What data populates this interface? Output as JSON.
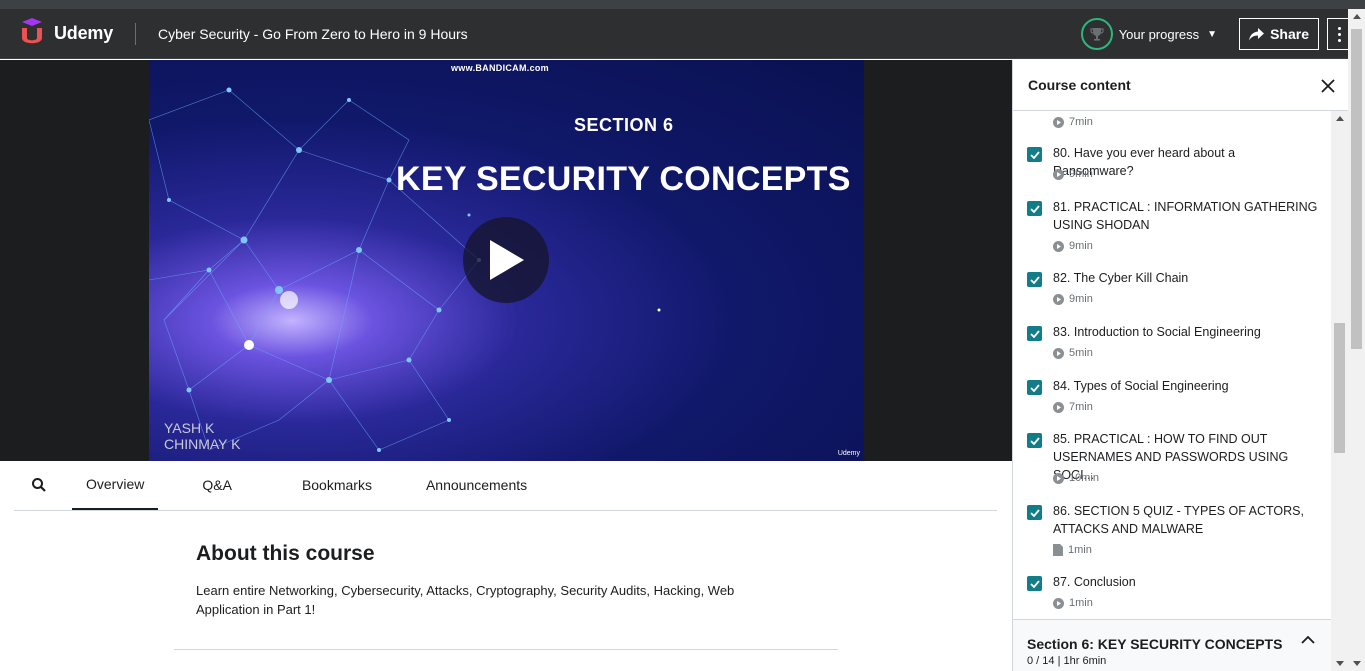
{
  "header": {
    "brand": "Udemy",
    "course_title": "Cyber Security - Go From Zero to Hero in 9 Hours",
    "progress_label": "Your progress",
    "share_label": "Share",
    "colors": {
      "bar": "#2d2f31",
      "brand": "#a435f0",
      "progress_ring": "#2eb67d"
    }
  },
  "video": {
    "watermark": "www.BANDICAM.com",
    "section": "SECTION 6",
    "title": "KEY SECURITY CONCEPTS",
    "author_1": "YASH K",
    "author_2": "CHINMAY K",
    "corner_logo": "Udemy"
  },
  "tabs": [
    {
      "label": "Overview",
      "active": true
    },
    {
      "label": "Q&A",
      "active": false
    },
    {
      "label": "Bookmarks",
      "active": false
    },
    {
      "label": "Announcements",
      "active": false
    }
  ],
  "about": {
    "heading": "About this course",
    "text": "Learn entire Networking, Cybersecurity, Attacks, Cryptography, Security Audits, Hacking, Web Application in Part 1!"
  },
  "sidebar": {
    "title": "Course content",
    "first_duration": "7min",
    "items": [
      {
        "title": "80. Have you ever heard about a Ransomware?",
        "duration": "9min",
        "type": "video",
        "checked": true
      },
      {
        "title": "81. PRACTICAL : INFORMATION GATHERING USING SHODAN",
        "duration": "9min",
        "type": "video",
        "checked": true
      },
      {
        "title": "82. The Cyber Kill Chain",
        "duration": "9min",
        "type": "video",
        "checked": true
      },
      {
        "title": "83. Introduction to Social Engineering",
        "duration": "5min",
        "type": "video",
        "checked": true
      },
      {
        "title": "84. Types of Social Engineering",
        "duration": "7min",
        "type": "video",
        "checked": true
      },
      {
        "title": "85. PRACTICAL : HOW TO FIND OUT USERNAMES AND PASSWORDS USING SOCI...",
        "duration": "10min",
        "type": "video",
        "checked": true
      },
      {
        "title": "86. SECTION 5 QUIZ - TYPES OF ACTORS, ATTACKS AND MALWARE",
        "duration": "1min",
        "type": "quiz",
        "checked": true
      },
      {
        "title": "87. Conclusion",
        "duration": "1min",
        "type": "video",
        "checked": true
      }
    ],
    "section_footer": {
      "title": "Section 6: KEY SECURITY CONCEPTS",
      "meta": "0 / 14 | 1hr 6min"
    },
    "colors": {
      "checkbox": "#127c89"
    }
  }
}
